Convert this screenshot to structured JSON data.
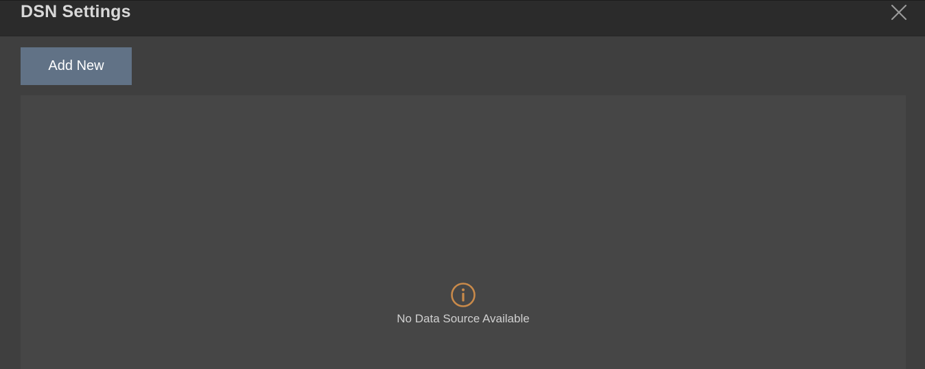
{
  "dialog": {
    "title": "DSN Settings",
    "close_icon": "close-icon"
  },
  "toolbar": {
    "add_label": "Add New"
  },
  "empty_state": {
    "icon": "info-icon",
    "message": "No Data Source Available"
  },
  "colors": {
    "titlebar_bg": "#2b2b2b",
    "dialog_bg": "#3f3f3f",
    "content_bg": "#464646",
    "button_bg": "#617286",
    "info_accent": "#c98a4a"
  }
}
